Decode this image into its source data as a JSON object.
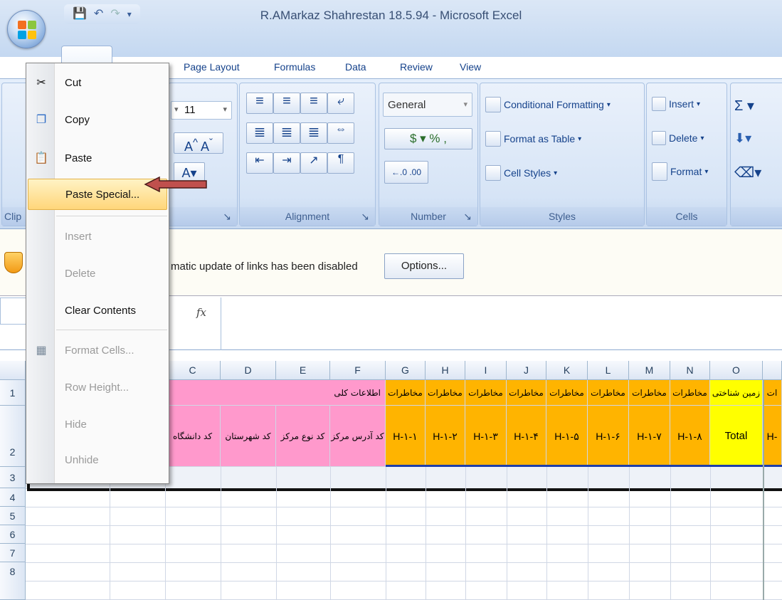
{
  "title": "R.AMarkaz Shahrestan 18.5.94 - Microsoft Excel",
  "tabs": [
    "Page Layout",
    "Formulas",
    "Data",
    "Review",
    "View"
  ],
  "ribbon": {
    "font_size": "11",
    "number_format": "General",
    "styles": {
      "conditional": "Conditional Formatting",
      "format_table": "Format as Table",
      "cell_styles": "Cell Styles"
    },
    "cells": {
      "insert": "Insert",
      "delete": "Delete",
      "format": "Format"
    },
    "groups": {
      "clipboard": "Clip",
      "alignment": "Alignment",
      "number": "Number",
      "styles": "Styles",
      "cells": "Cells"
    }
  },
  "info_bar": {
    "text": "matic update of links has been disabled",
    "button": "Options..."
  },
  "formula_bar": {
    "fx": "fx"
  },
  "context_menu": [
    {
      "label": "Cut",
      "icon": "scissors-icon",
      "enabled": true
    },
    {
      "label": "Copy",
      "icon": "copy-icon",
      "enabled": true
    },
    {
      "label": "Paste",
      "icon": "paste-icon",
      "enabled": true
    },
    {
      "label": "Paste Special...",
      "icon": "",
      "enabled": true,
      "highlighted": true
    },
    {
      "label": "Insert",
      "icon": "",
      "enabled": false
    },
    {
      "label": "Delete",
      "icon": "",
      "enabled": false
    },
    {
      "label": "Clear Contents",
      "icon": "",
      "enabled": true
    },
    {
      "label": "Format Cells...",
      "icon": "format-cells-icon",
      "enabled": false
    },
    {
      "label": "Row Height...",
      "icon": "",
      "enabled": false
    },
    {
      "label": "Hide",
      "icon": "",
      "enabled": false
    },
    {
      "label": "Unhide",
      "icon": "",
      "enabled": false
    }
  ],
  "grid": {
    "columns": [
      "C",
      "D",
      "E",
      "F",
      "G",
      "H",
      "I",
      "J",
      "K",
      "L",
      "M",
      "N",
      "O"
    ],
    "rows": [
      "1",
      "2",
      "3",
      "4",
      "5",
      "6",
      "7",
      "8"
    ],
    "row1": {
      "merged_pink": "اطلاعات کلی",
      "orange_labels": [
        "مخاطرات",
        "مخاطرات",
        "مخاطرات",
        "مخاطرات",
        "مخاطرات",
        "مخاطرات",
        "مخاطرات",
        "مخاطرات"
      ],
      "yellow_label": "زمین شناختی",
      "edge_label": "ات"
    },
    "row2": {
      "pink_labels": [
        "کد دانشگاه",
        "کد شهرستان",
        "کد نوع مرکز",
        "کد آدرس مرکز"
      ],
      "orange_labels": [
        "H-۱-۱",
        "H-۱-۲",
        "H-۱-۳",
        "H-۱-۴",
        "H-۱-۵",
        "H-۱-۶",
        "H-۱-۷",
        "H-۱-۸"
      ],
      "yellow_label": "Total",
      "edge_label": "H-"
    }
  },
  "colors": {
    "pink": "#ff99cc",
    "orange": "#ffb400",
    "yellow": "#ffff00",
    "highlight": "#ffd67a"
  }
}
